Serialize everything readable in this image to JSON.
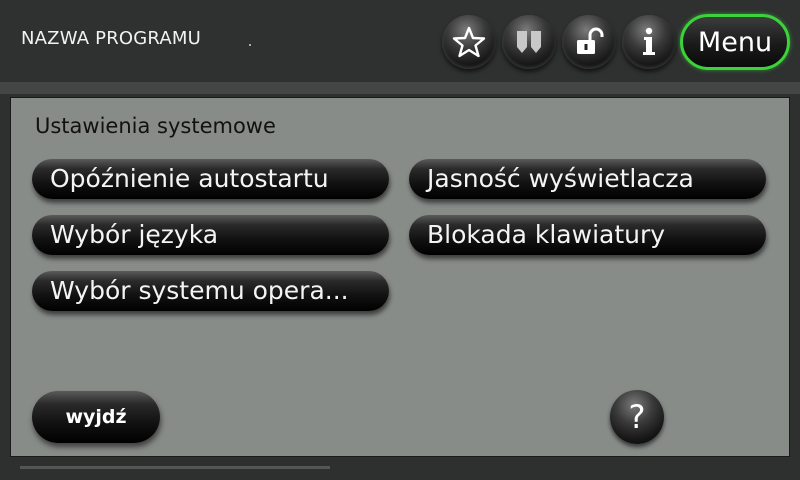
{
  "header": {
    "app_title": "NAZWA PROGRAMU",
    "menu_label": "Menu",
    "icons": [
      "star-icon",
      "book-icon",
      "unlock-icon",
      "info-icon"
    ]
  },
  "panel": {
    "title": "Ustawienia systemowe",
    "buttons": [
      "Opóźnienie autostartu",
      "Jasność wyświetlacza",
      "Wybór języka",
      "Blokada klawiatury",
      "Wybór systemu opera..."
    ],
    "exit_label": "wyjdź",
    "help_label": "?"
  },
  "colors": {
    "accent": "#3bd23b",
    "panel_bg": "#888c89",
    "topbar_bg": "#2f3130"
  }
}
